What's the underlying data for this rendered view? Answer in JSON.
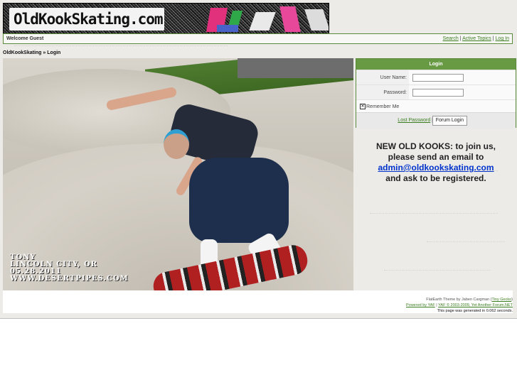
{
  "banner": {
    "logo_text": "OldKookSkating.com"
  },
  "welcome_bar": {
    "title": "Welcome Guest",
    "links": [
      "Search",
      "Active Topics",
      "Log In"
    ]
  },
  "breadcrumb": {
    "home": "OldKookSkating",
    "separator": "»",
    "current": "Login"
  },
  "photo": {
    "caption_lines": [
      "TONY",
      "LINCOLN CITY, OR",
      "05.28.2011",
      "WWW.DESERTPIPES.COM"
    ]
  },
  "login": {
    "header": "Login",
    "username_label": "User Name:",
    "username_value": "",
    "password_label": "Password:",
    "password_value": "",
    "remember_label": "Remember Me",
    "remember_checked": true,
    "lost_password": "Lost Password",
    "separator": "|",
    "submit_label": "Forum Login"
  },
  "notice": {
    "line1": "NEW OLD KOOKS: to join us,",
    "line2": "please send an email to",
    "email": "admin@oldkookskating.com",
    "line3": "and ask to be registered."
  },
  "footer": {
    "theme_text": "FlatEarth Theme by Jaben Cargman (",
    "theme_link": "Tiny Gecko",
    "theme_close": ")",
    "powered": "Powered by YAF",
    "sep": "|",
    "yaf_copy": "YAF © 2003-2009, Yet Another Forum.NET",
    "generated": "This page was generated in 0.062 seconds."
  },
  "colors": {
    "accent": "#689a44",
    "border": "#5a8a3a",
    "link": "#3a7d1e",
    "email": "#0033cc"
  }
}
